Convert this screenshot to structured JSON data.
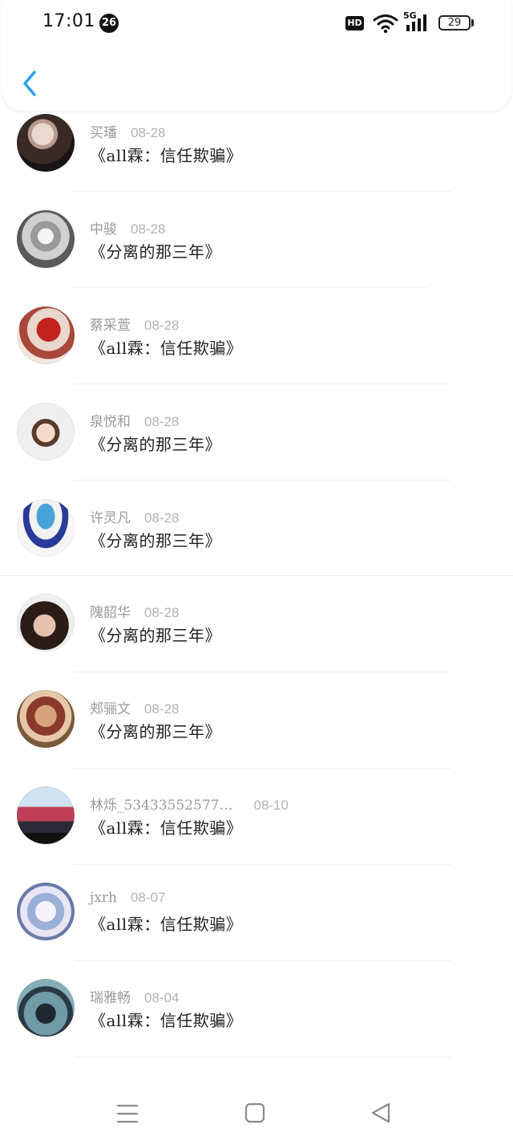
{
  "status_bar": {
    "time": "17:01",
    "notification_count": "26",
    "hd_label": "HD",
    "network_label": "5G",
    "battery_level": "29",
    "icons": [
      "wifi-icon",
      "signal-icon",
      "battery-icon"
    ]
  },
  "header": {
    "back_icon": "chevron-left-icon",
    "accent_color": "#2aa1e6"
  },
  "comments": [
    {
      "name": "买璠",
      "date": "08-28",
      "work": "《all霖：信任欺骗》"
    },
    {
      "name": "中骏",
      "date": "08-28",
      "work": "《分离的那三年》"
    },
    {
      "name": "蔡采萱",
      "date": "08-28",
      "work": "《all霖：信任欺骗》"
    },
    {
      "name": "泉悦和",
      "date": "08-28",
      "work": "《分离的那三年》"
    },
    {
      "name": "许灵凡",
      "date": "08-28",
      "work": "《分离的那三年》"
    },
    {
      "name": "隗韶华",
      "date": "08-28",
      "work": "《分离的那三年》"
    },
    {
      "name": "郏骊文",
      "date": "08-28",
      "work": "《分离的那三年》"
    },
    {
      "name": "林烁_53433552577…",
      "date": "08-10",
      "work": "《all霖：信任欺骗》"
    },
    {
      "name": "jxrh",
      "date": "08-07",
      "work": "《all霖：信任欺骗》"
    },
    {
      "name": "瑞雅畅",
      "date": "08-04",
      "work": "《all霖：信任欺骗》"
    }
  ],
  "nav_bar": {
    "icons": [
      "menu-icon",
      "home-icon",
      "back-triangle-icon"
    ]
  }
}
